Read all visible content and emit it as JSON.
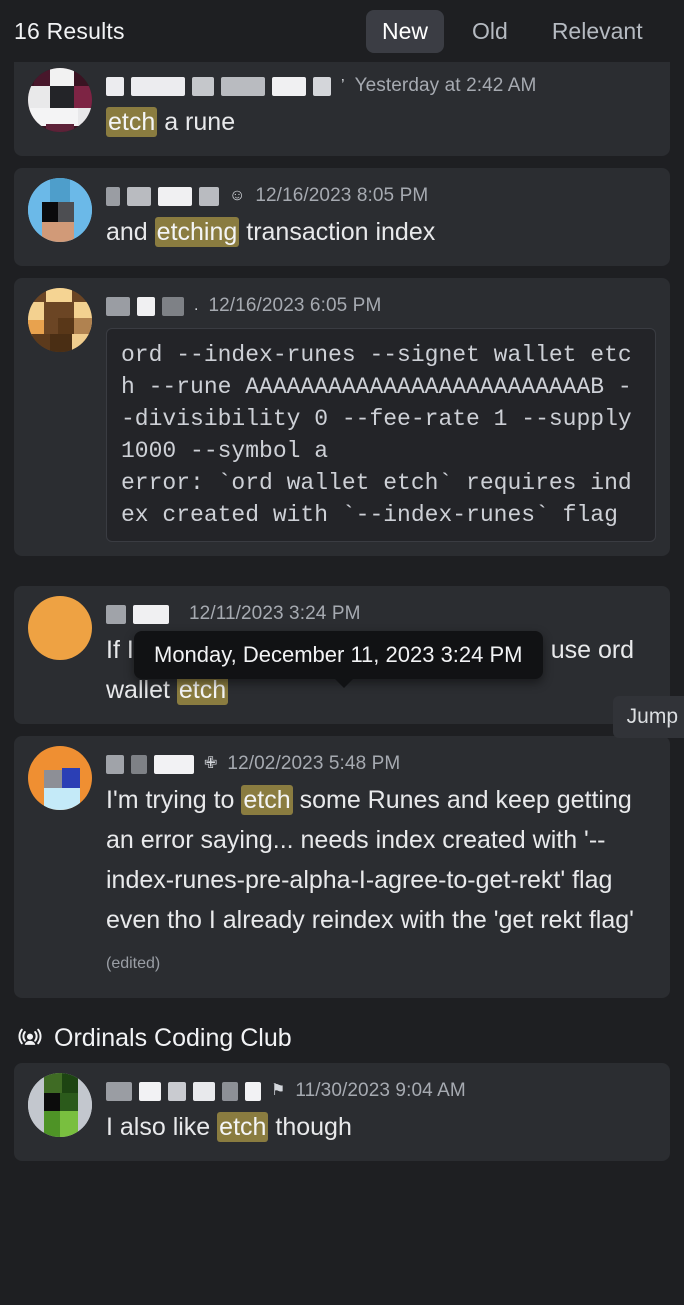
{
  "header": {
    "results_count": "16 Results",
    "tabs": [
      {
        "label": "New",
        "active": true
      },
      {
        "label": "Old",
        "active": false
      },
      {
        "label": "Relevant",
        "active": false
      }
    ]
  },
  "tooltip": {
    "text": "Monday, December 11, 2023 3:24 PM"
  },
  "jump_button": {
    "label": "Jump"
  },
  "channel_group": {
    "icon": "stage-channel-icon",
    "name": "Ordinals Coding Club"
  },
  "results": [
    {
      "id": "result-1",
      "author": "redacted",
      "timestamp": "Yesterday at 2:42 AM",
      "badge": "’",
      "text_before": "",
      "highlight": "etch",
      "text_after": " a rune",
      "edited": ""
    },
    {
      "id": "result-2",
      "author": "redacted",
      "timestamp": "12/16/2023 8:05 PM",
      "badge": "☺",
      "text_before": "and ",
      "highlight": "etching",
      "text_after": " transaction index",
      "edited": ""
    },
    {
      "id": "result-3",
      "author": "redacted",
      "timestamp": "12/16/2023 6:05 PM",
      "badge": ".",
      "code": "ord --index-runes --signet wallet etch --rune AAAAAAAAAAAAAAAAAAAAAAAAAB --divisibility 0 --fee-rate 1 --supply 1000 --symbol a\nerror: `ord wallet etch` requires index created with `--index-runes` flag"
    },
    {
      "id": "result-4",
      "author": "redacted",
      "timestamp": "12/11/2023 3:24 PM",
      "badge": "",
      "text_before": "If I want to deloy an inscription, should I use ord wallet ",
      "highlight": "etch",
      "text_after": "",
      "edited": ""
    },
    {
      "id": "result-5",
      "author": "redacted",
      "timestamp": "12/02/2023 5:48 PM",
      "badge": "✙",
      "text_before": "I'm trying to ",
      "highlight": "etch",
      "text_after": " some Runes and keep getting an error saying... needs index created with '--index-runes-pre-alpha-I-agree-to-get-rekt' flag even tho I already reindex with the 'get rekt flag' ",
      "edited": "(edited)"
    },
    {
      "id": "result-6",
      "author": "redacted",
      "timestamp": "11/30/2023 9:04 AM",
      "badge": "⚑",
      "text_before": "I also like ",
      "highlight": "etch",
      "text_after": " though",
      "edited": ""
    }
  ],
  "colors": {
    "page_bg": "#1e1f22",
    "card_bg": "#2b2d31",
    "highlight": "#8a7c40",
    "tab_active_bg": "#3b3d44",
    "text_primary": "#e8e9eb",
    "text_muted": "#a6aab1",
    "code_bg": "#232428",
    "tooltip_bg": "#111214"
  }
}
